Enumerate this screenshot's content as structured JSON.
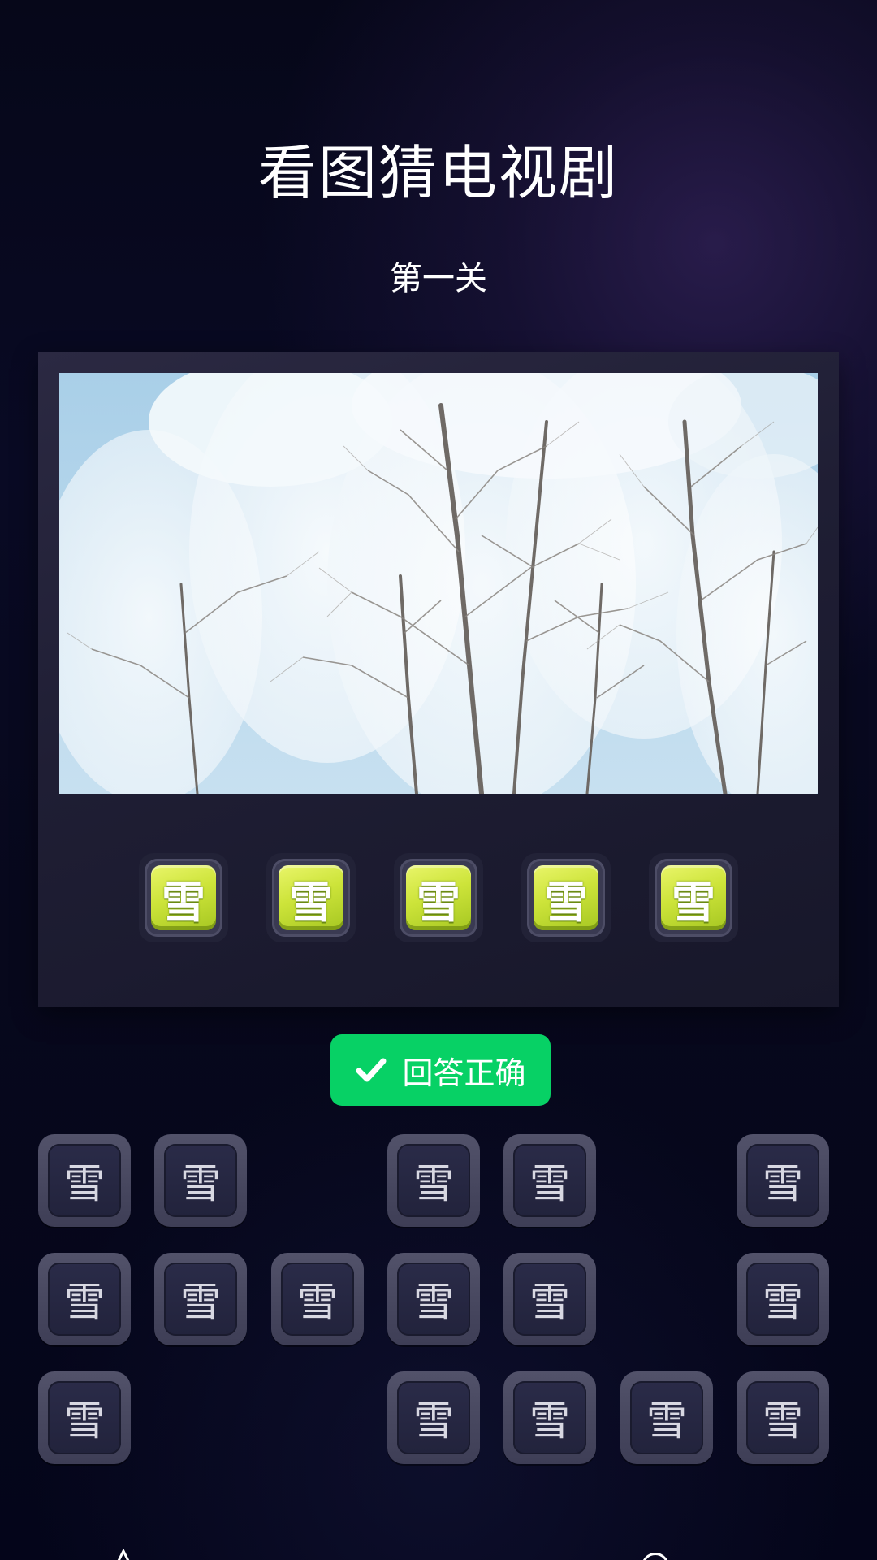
{
  "header": {
    "title": "看图猜电视剧",
    "level": "第一关"
  },
  "answer": {
    "slots": [
      "雪",
      "雪",
      "雪",
      "雪",
      "雪"
    ],
    "result_label": "回答正确",
    "result_icon": "check-icon",
    "result_color": "#07d165"
  },
  "keyboard": {
    "rows": [
      [
        "雪",
        "雪",
        "",
        "雪",
        "雪",
        "",
        "雪"
      ],
      [
        "雪",
        "雪",
        "雪",
        "雪",
        "雪",
        "",
        "雪"
      ],
      [
        "雪",
        "",
        "",
        "雪",
        "雪",
        "雪",
        "雪"
      ]
    ]
  },
  "navigation": {
    "back_icon": "back-icon",
    "home_icon": "home-icon"
  }
}
